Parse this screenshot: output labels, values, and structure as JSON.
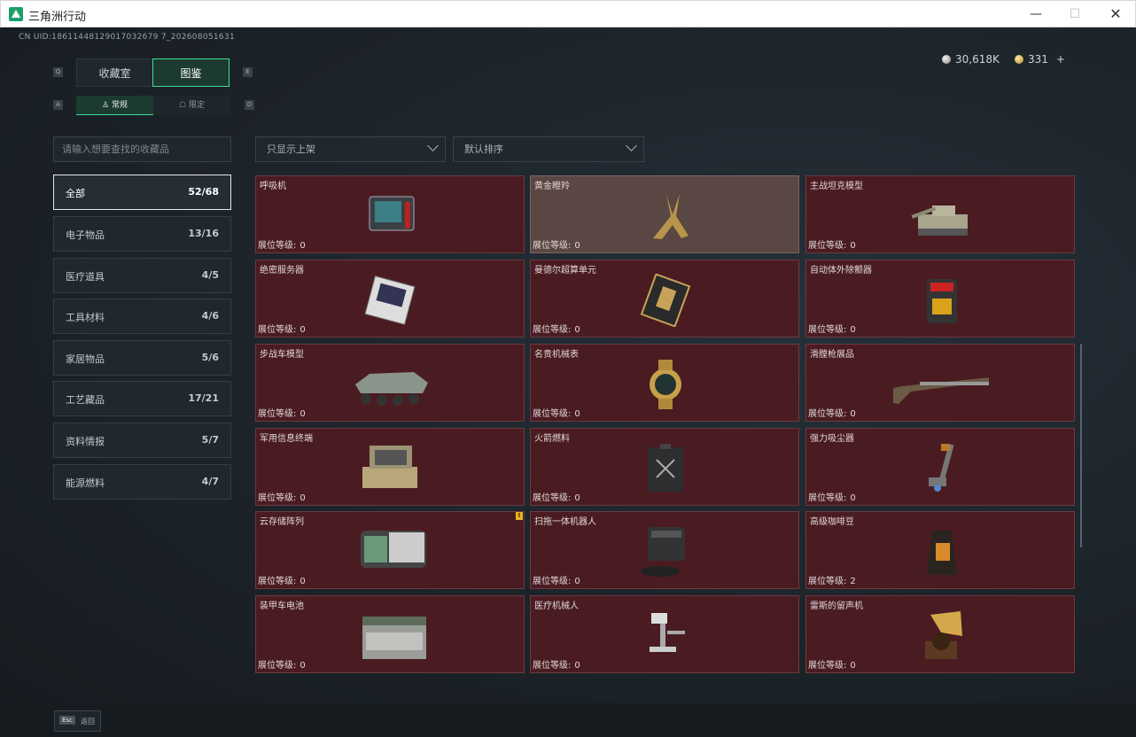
{
  "window": {
    "title": "三角洲行动",
    "minimize": "—",
    "maximize": "☐",
    "close": "✕"
  },
  "header": {
    "uid": "CN UID:18611448129017032679 7_202608051631",
    "currency_silver": "30,618K",
    "currency_gold": "331",
    "currency_add": "+"
  },
  "tabs": {
    "key_left": "Q",
    "key_right": "E",
    "primary": [
      "收藏室",
      "图鉴"
    ],
    "key_left_small": "A",
    "key_right_small": "D",
    "secondary": [
      "常规",
      "限定"
    ]
  },
  "filters": {
    "search_placeholder": "请输入想要查找的收藏品",
    "listing": "只显示上架",
    "sort": "默认排序"
  },
  "categories": [
    {
      "label": "全部",
      "count": "52/68"
    },
    {
      "label": "电子物品",
      "count": "13/16"
    },
    {
      "label": "医疗道具",
      "count": "4/5"
    },
    {
      "label": "工具材料",
      "count": "4/6"
    },
    {
      "label": "家居物品",
      "count": "5/6"
    },
    {
      "label": "工艺藏品",
      "count": "17/21"
    },
    {
      "label": "资料情报",
      "count": "5/7"
    },
    {
      "label": "能源燃料",
      "count": "4/7"
    }
  ],
  "level_label": "展位等级:",
  "items": [
    {
      "name": "呼吸机",
      "level": "0",
      "icon": "ventilator-icon"
    },
    {
      "name": "黄金瞪羚",
      "level": "0",
      "icon": "golden-gazelle-icon"
    },
    {
      "name": "主战坦克模型",
      "level": "0",
      "icon": "tank-model-icon"
    },
    {
      "name": "绝密服务器",
      "level": "0",
      "icon": "server-icon"
    },
    {
      "name": "曼德尔超算单元",
      "level": "0",
      "icon": "supercomputer-unit-icon"
    },
    {
      "name": "自动体外除颤器",
      "level": "0",
      "icon": "defibrillator-icon"
    },
    {
      "name": "步战车模型",
      "level": "0",
      "icon": "ifv-model-icon"
    },
    {
      "name": "名贵机械表",
      "level": "0",
      "icon": "watch-icon"
    },
    {
      "name": "滑膛枪展品",
      "level": "0",
      "icon": "musket-icon"
    },
    {
      "name": "军用信息终端",
      "level": "0",
      "icon": "military-terminal-icon"
    },
    {
      "name": "火箭燃料",
      "level": "0",
      "icon": "rocket-fuel-icon"
    },
    {
      "name": "强力吸尘器",
      "level": "0",
      "icon": "vacuum-icon"
    },
    {
      "name": "云存储阵列",
      "level": "0",
      "icon": "storage-array-icon",
      "badge": "!"
    },
    {
      "name": "扫拖一体机器人",
      "level": "0",
      "icon": "robot-vacuum-icon"
    },
    {
      "name": "高级咖啡豆",
      "level": "2",
      "icon": "coffee-beans-icon"
    },
    {
      "name": "装甲车电池",
      "level": "0",
      "icon": "battery-icon"
    },
    {
      "name": "医疗机械人",
      "level": "0",
      "icon": "medical-robot-icon"
    },
    {
      "name": "雷斯的留声机",
      "level": "0",
      "icon": "gramophone-icon"
    }
  ],
  "footer": {
    "esc_key": "Esc",
    "esc_label": "返回"
  },
  "colors": {
    "accent": "#3ddc97",
    "card_bg": "#4a1c22",
    "card_highlight": "#5a4642"
  }
}
